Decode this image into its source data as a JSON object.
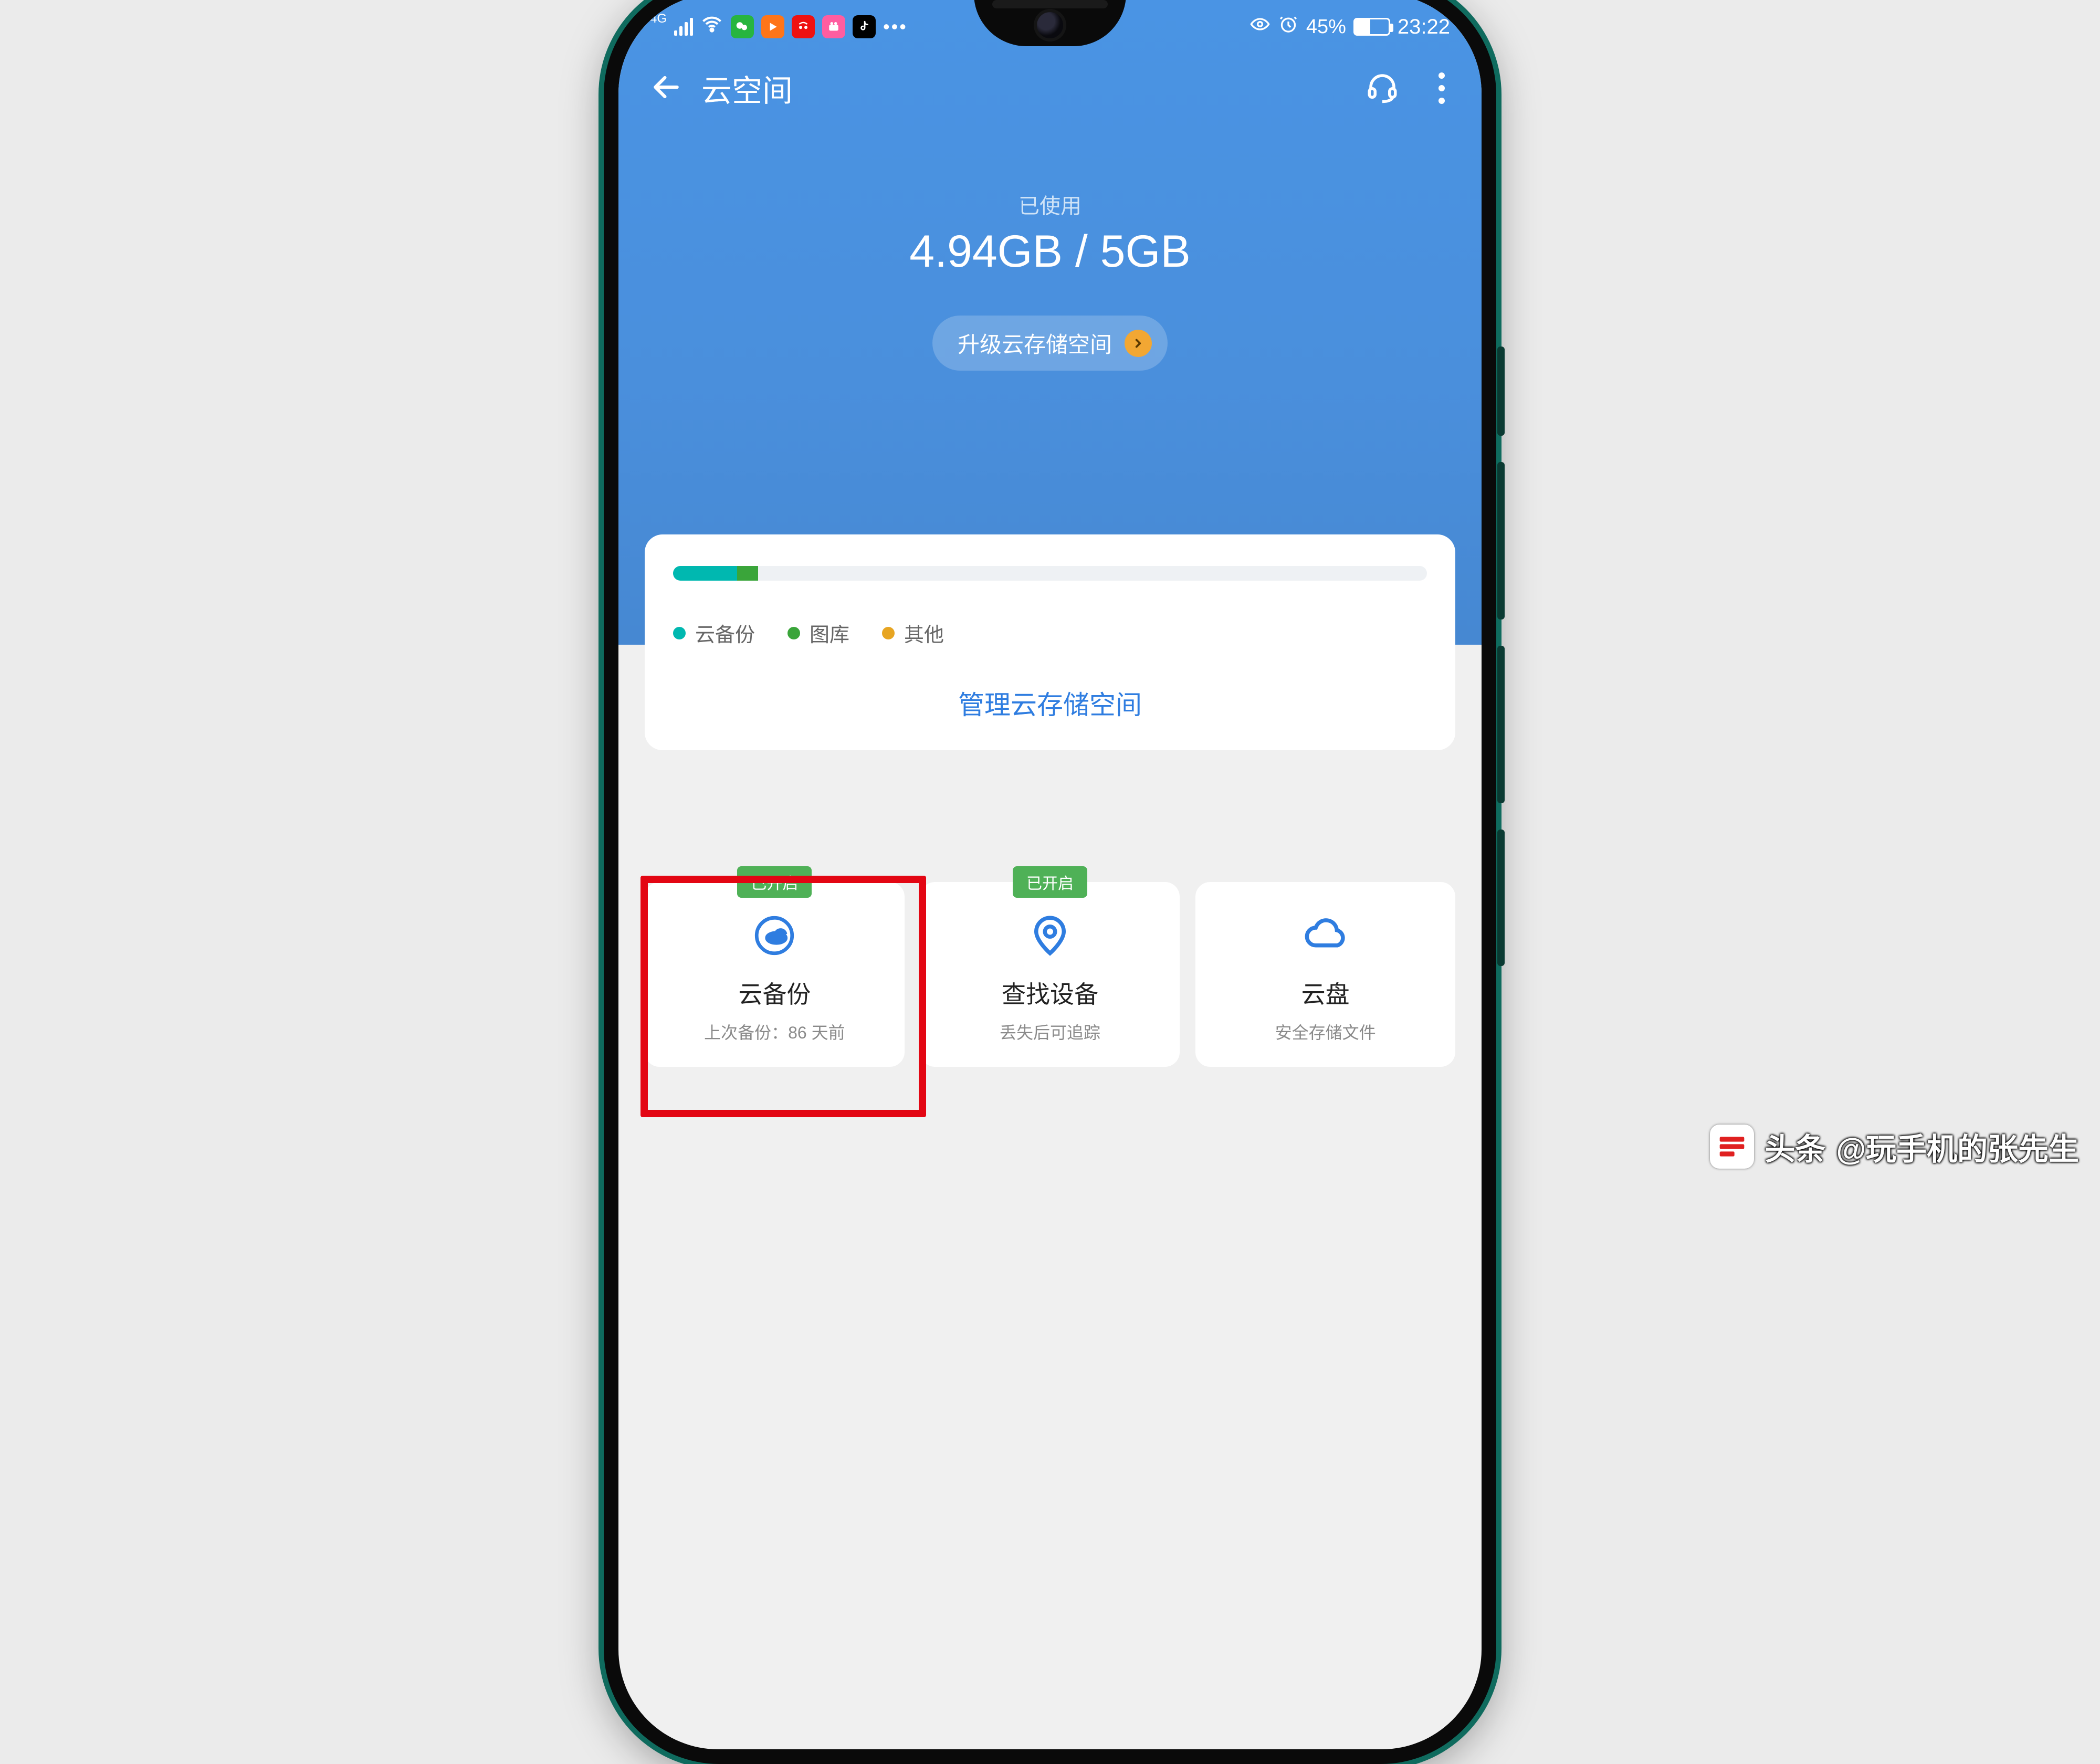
{
  "status_bar": {
    "network_label": "4G",
    "battery_pct": "45%",
    "time": "23:22"
  },
  "nav": {
    "title": "云空间"
  },
  "usage": {
    "label": "已使用",
    "value": "4.94GB / 5GB",
    "upgrade_label": "升级云存储空间"
  },
  "storage_card": {
    "legend": {
      "backup": "云备份",
      "gallery": "图库",
      "other": "其他"
    },
    "manage_link": "管理云存储空间"
  },
  "tiles": {
    "enabled_badge": "已开启",
    "backup": {
      "title": "云备份",
      "sub": "上次备份：86 天前"
    },
    "find": {
      "title": "查找设备",
      "sub": "丢失后可追踪"
    },
    "drive": {
      "title": "云盘",
      "sub": "安全存储文件"
    }
  },
  "watermark": {
    "brand": "头条",
    "author": "@玩手机的张先生"
  },
  "colors": {
    "accent_blue": "#2f7de0",
    "teal": "#00b8b0",
    "green": "#3aa53a",
    "amber": "#e7a522",
    "badge_green": "#4fb157",
    "highlight_red": "#e30613"
  }
}
